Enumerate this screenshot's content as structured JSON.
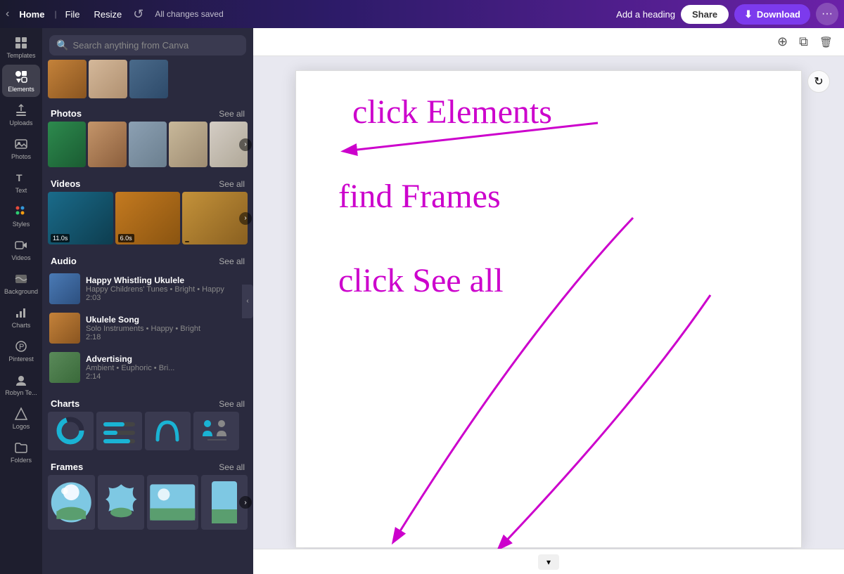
{
  "topbar": {
    "home": "Home",
    "file": "File",
    "resize": "Resize",
    "saved_status": "All changes saved",
    "add_heading": "Add a heading",
    "share": "Share",
    "download": "Download"
  },
  "sidebar": {
    "items": [
      {
        "id": "templates",
        "label": "Templates",
        "icon": "grid-icon"
      },
      {
        "id": "elements",
        "label": "Elements",
        "icon": "elements-icon",
        "active": true
      },
      {
        "id": "uploads",
        "label": "Uploads",
        "icon": "upload-icon"
      },
      {
        "id": "photos",
        "label": "Photos",
        "icon": "photo-icon"
      },
      {
        "id": "text",
        "label": "Text",
        "icon": "text-icon"
      },
      {
        "id": "styles",
        "label": "Styles",
        "icon": "styles-icon"
      },
      {
        "id": "videos",
        "label": "Videos",
        "icon": "videos-icon"
      },
      {
        "id": "background",
        "label": "Background",
        "icon": "background-icon"
      },
      {
        "id": "charts",
        "label": "Charts",
        "icon": "charts-icon"
      },
      {
        "id": "pinterest",
        "label": "Pinterest",
        "icon": "pinterest-icon"
      },
      {
        "id": "robyn",
        "label": "Robyn Te...",
        "icon": "robyn-icon"
      },
      {
        "id": "logos",
        "label": "Logos",
        "icon": "logos-icon"
      },
      {
        "id": "folders",
        "label": "Folders",
        "icon": "folders-icon"
      }
    ]
  },
  "panel": {
    "search_placeholder": "Search anything from Canva",
    "sections": [
      {
        "id": "photos",
        "title": "Photos",
        "see_all": "See all"
      },
      {
        "id": "videos",
        "title": "Videos",
        "see_all": "See all"
      },
      {
        "id": "audio",
        "title": "Audio",
        "see_all": "See all"
      },
      {
        "id": "charts",
        "title": "Charts",
        "see_all": "See all"
      },
      {
        "id": "frames",
        "title": "Frames",
        "see_all": "See all"
      }
    ],
    "audio_tracks": [
      {
        "title": "Happy Whistling Ukulele",
        "desc": "Happy Childrens' Tunes • Bright • Happy",
        "duration": "2:03"
      },
      {
        "title": "Ukulele Song",
        "desc": "Solo Instruments • Happy • Bright",
        "duration": "2:18"
      },
      {
        "title": "Advertising",
        "desc": "Ambient • Euphoric • Bri...",
        "duration": "2:14"
      }
    ],
    "videos": [
      {
        "duration": "11.0s"
      },
      {
        "duration": "6.0s"
      },
      {
        "duration": ""
      }
    ]
  },
  "canvas": {
    "instructions": [
      {
        "id": "click-elements",
        "text": "click Elements"
      },
      {
        "id": "find-frames",
        "text": "find Frames"
      },
      {
        "id": "click-see-all",
        "text": "click See all"
      }
    ],
    "bottom_nav": "▾"
  },
  "canvas_tools": {
    "new_page": "⊕",
    "duplicate": "⧉",
    "delete": "🗑",
    "refresh": "↻"
  }
}
